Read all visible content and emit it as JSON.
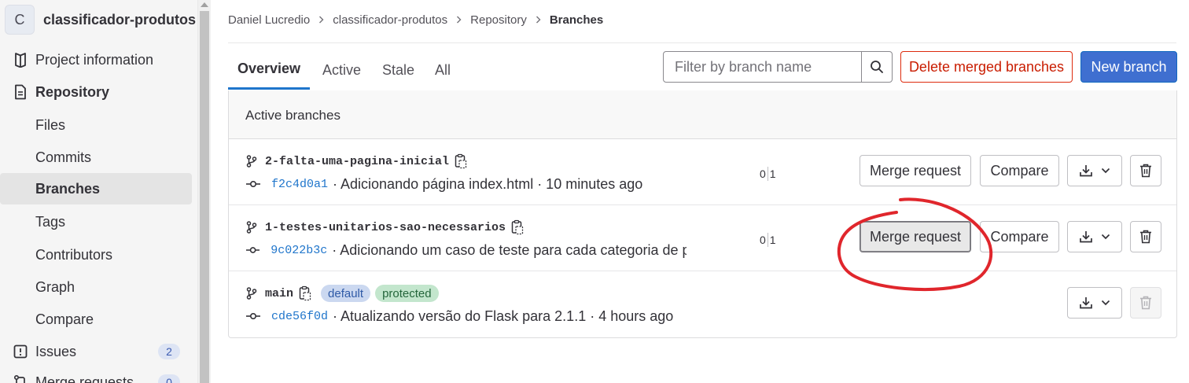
{
  "sidebar": {
    "project": {
      "avatar_letter": "C",
      "name": "classificador-produtos"
    },
    "items": [
      {
        "label": "Project information",
        "icon": "project-info-icon"
      },
      {
        "label": "Repository",
        "icon": "document-icon"
      },
      {
        "label": "Files"
      },
      {
        "label": "Commits"
      },
      {
        "label": "Branches",
        "active": true
      },
      {
        "label": "Tags"
      },
      {
        "label": "Contributors"
      },
      {
        "label": "Graph"
      },
      {
        "label": "Compare"
      },
      {
        "label": "Issues",
        "icon": "issues-icon",
        "count": "2"
      },
      {
        "label": "Merge requests",
        "icon": "merge-request-icon",
        "count": "0"
      }
    ]
  },
  "breadcrumb": [
    "Daniel Lucredio",
    "classificador-produtos",
    "Repository",
    "Branches"
  ],
  "tabs": [
    "Overview",
    "Active",
    "Stale",
    "All"
  ],
  "filter": {
    "placeholder": "Filter by branch name"
  },
  "buttons": {
    "delete_merged": "Delete merged branches",
    "new_branch": "New branch"
  },
  "panel": {
    "title": "Active branches",
    "branches": [
      {
        "name": "2-falta-uma-pagina-inicial",
        "sha": "f2c4d0a1",
        "message": "· Adicionando página index.html · 10 minutes ago",
        "behind": "0",
        "ahead": "1",
        "merge_request": "Merge request",
        "compare": "Compare"
      },
      {
        "name": "1-testes-unitarios-sao-necessarios",
        "sha": "9c022b3c",
        "message": "· Adicionando um caso de teste para cada categoria de pro",
        "behind": "0",
        "ahead": "1",
        "merge_request": "Merge request",
        "compare": "Compare"
      },
      {
        "name": "main",
        "badges": [
          "default",
          "protected"
        ],
        "sha": "cde56f0d",
        "message": "· Atualizando versão do Flask para 2.1.1 · 4 hours ago"
      }
    ]
  },
  "colors": {
    "accent": "#1f75cb",
    "danger": "#dd2b0e",
    "annotation": "#e0262c"
  }
}
